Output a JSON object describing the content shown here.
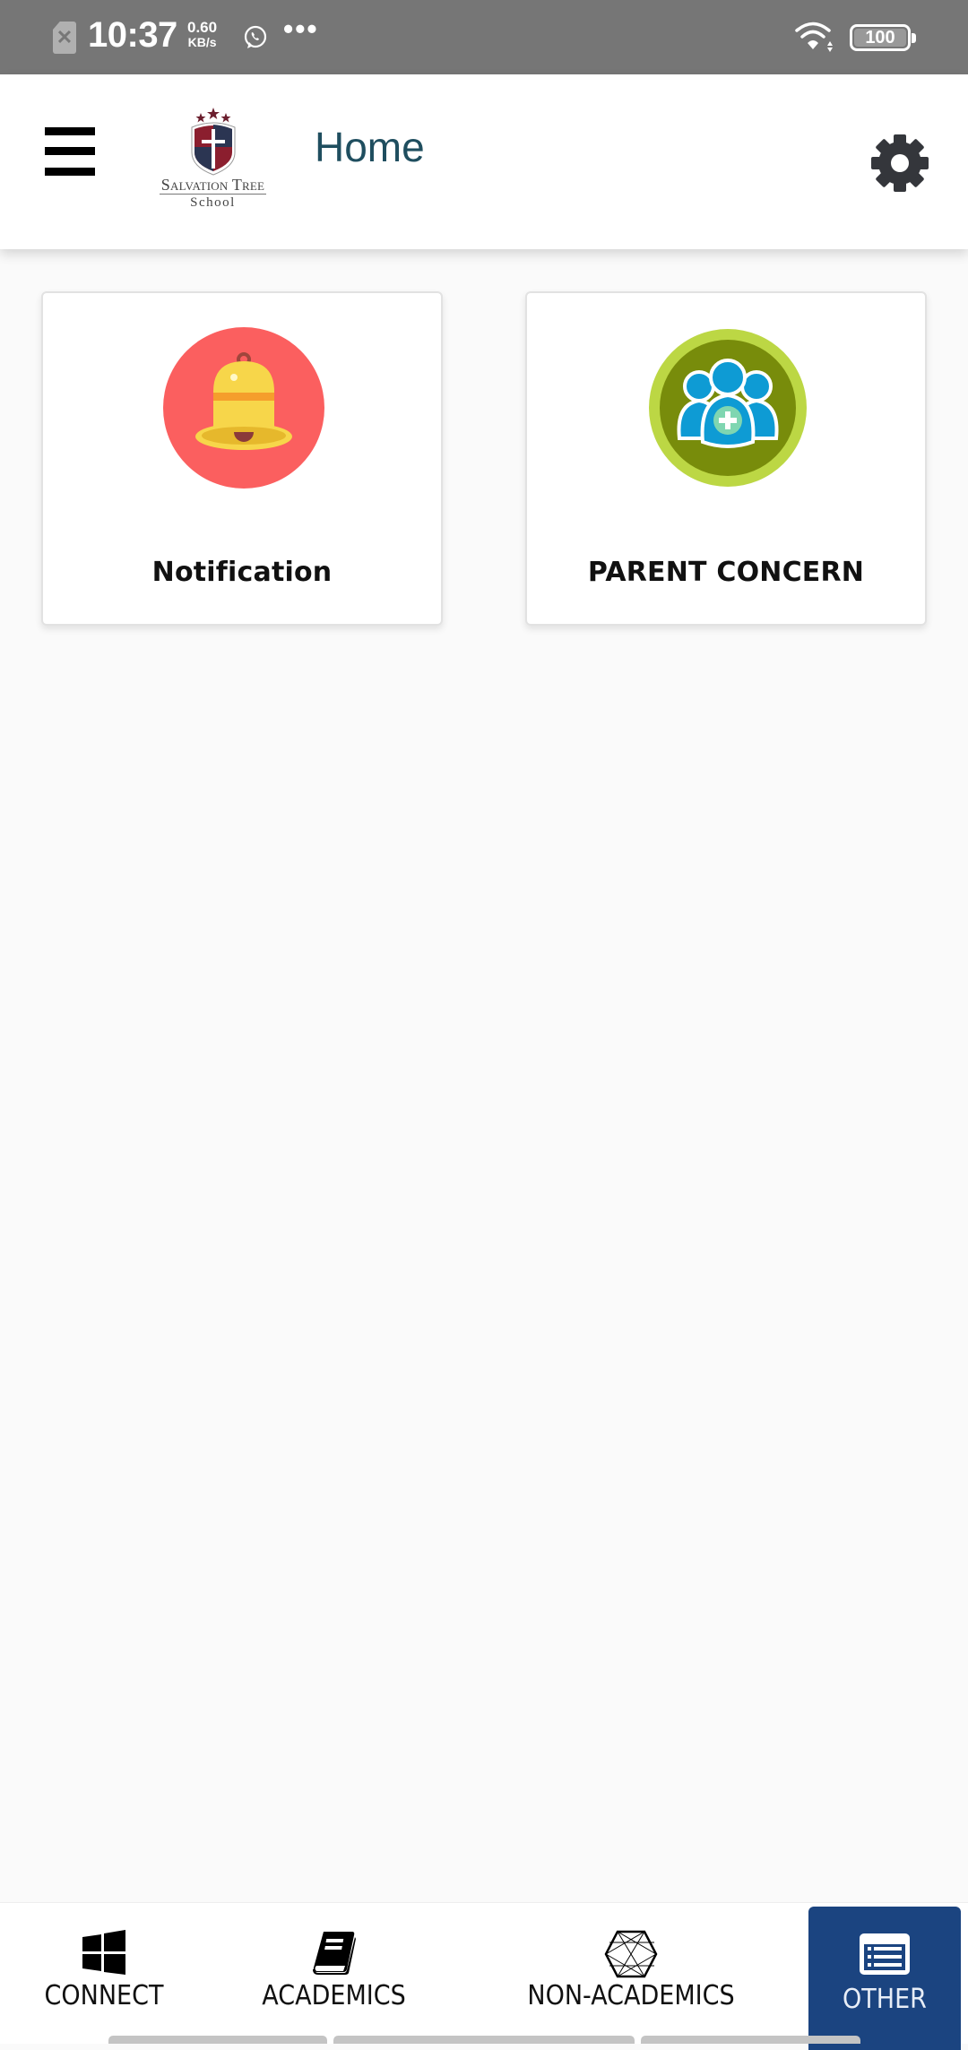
{
  "status_bar": {
    "time": "10:37",
    "net_speed_value": "0.60",
    "net_speed_unit": "KB/s",
    "more_indicator": "•••",
    "battery_level": "100",
    "sim_status": "✕"
  },
  "header": {
    "title": "Home",
    "logo_line1": "Salvation Tree",
    "logo_line2": "School",
    "logo_colors": {
      "shield_red": "#8b1e2e",
      "shield_navy": "#2b3552"
    }
  },
  "tiles": [
    {
      "label": "Notification",
      "icon": "bell-icon",
      "icon_bg": "#fb5f5f"
    },
    {
      "label": "PARENT CONCERN",
      "icon": "parent-group-icon",
      "icon_bg": "#788c0b"
    }
  ],
  "bottom_nav": {
    "active_color": "#1b4480",
    "items": [
      {
        "label": "CONNECT",
        "icon": "windows-grid-icon",
        "active": false
      },
      {
        "label": "ACADEMICS",
        "icon": "book-icon",
        "active": false
      },
      {
        "label": "NON-ACADEMICS",
        "icon": "hexagon-network-icon",
        "active": false
      },
      {
        "label": "OTHER",
        "icon": "list-card-icon",
        "active": true
      }
    ]
  }
}
